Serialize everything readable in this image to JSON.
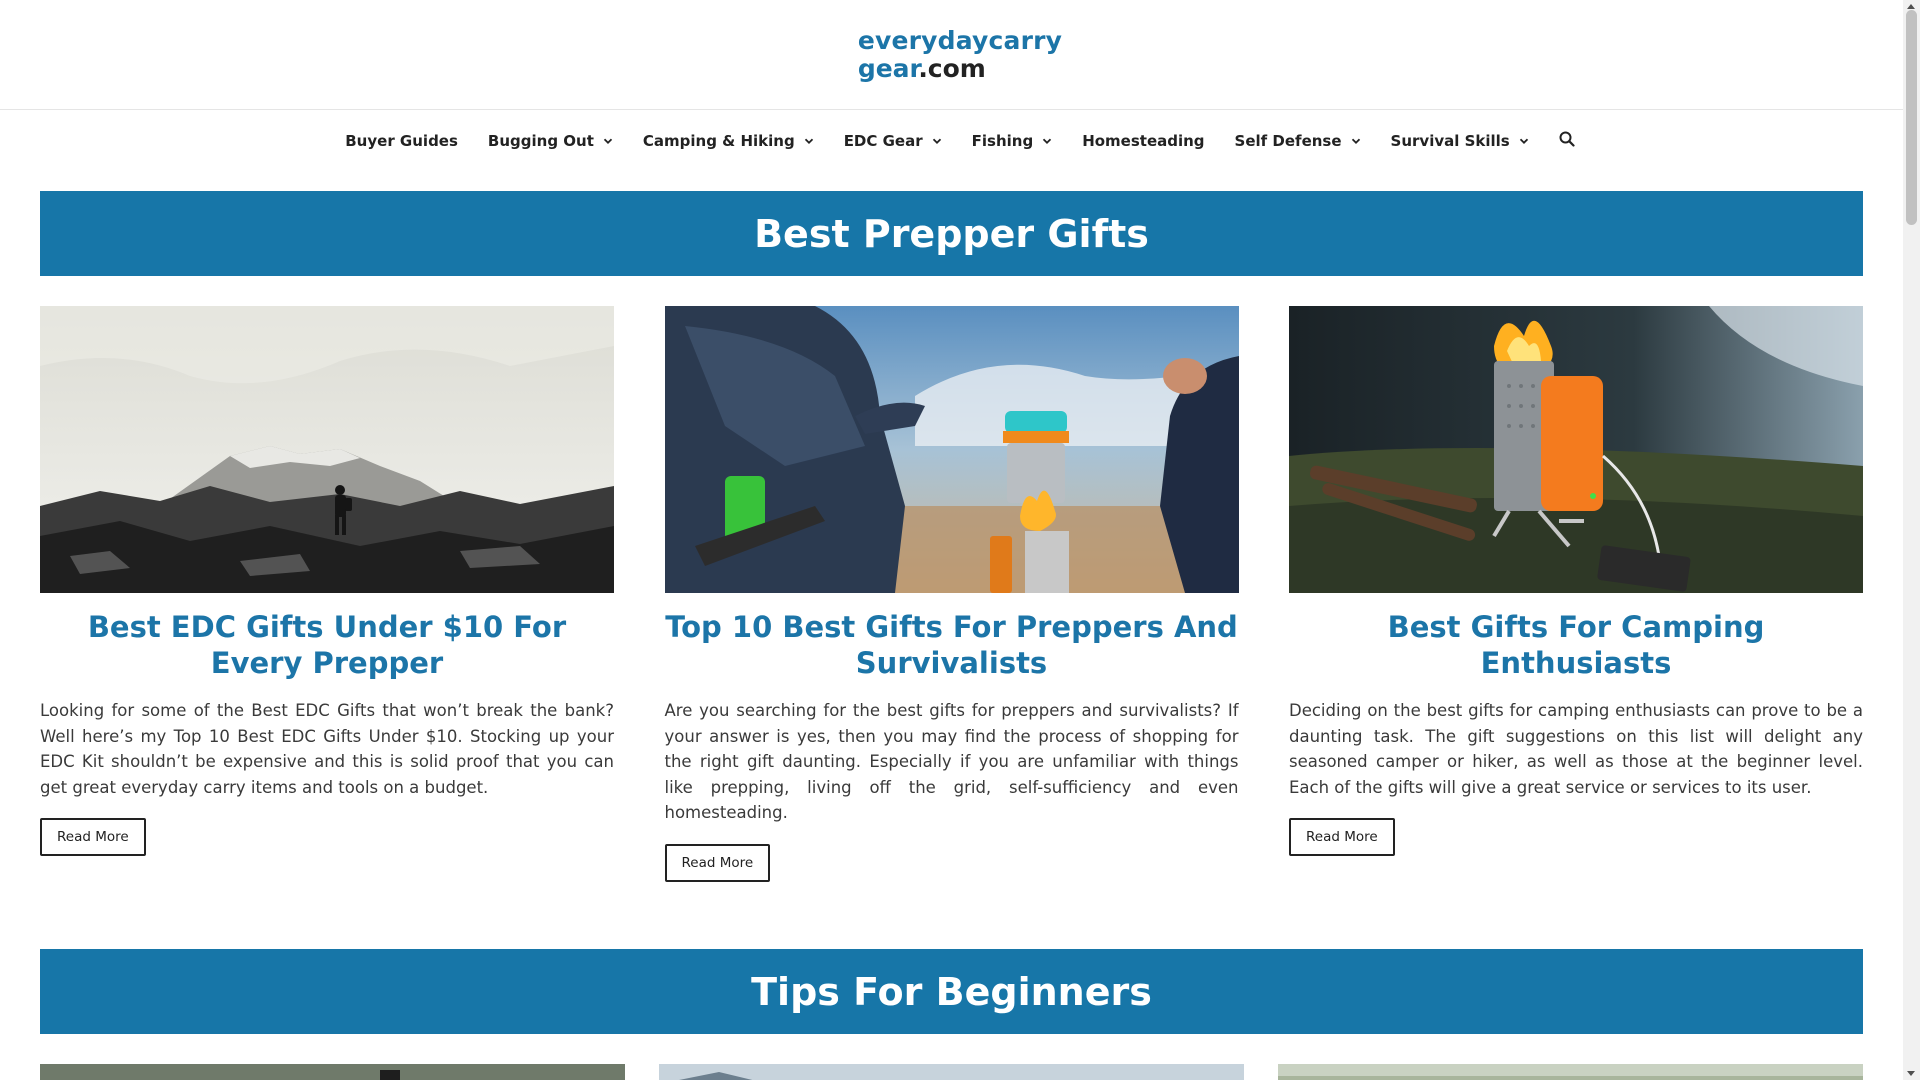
{
  "logo": {
    "line1": "everydaycarry",
    "line2_a": "gear",
    "line2_b": ".com"
  },
  "nav": {
    "items": [
      {
        "label": "Buyer Guides",
        "has_dropdown": false
      },
      {
        "label": "Bugging Out",
        "has_dropdown": true
      },
      {
        "label": "Camping & Hiking",
        "has_dropdown": true
      },
      {
        "label": "EDC Gear",
        "has_dropdown": true
      },
      {
        "label": "Fishing",
        "has_dropdown": true
      },
      {
        "label": "Homesteading",
        "has_dropdown": false
      },
      {
        "label": "Self Defense",
        "has_dropdown": true
      },
      {
        "label": "Survival Skills",
        "has_dropdown": true
      }
    ],
    "search_icon": "search-icon"
  },
  "sections": [
    {
      "heading": "Best Prepper Gifts",
      "cards": [
        {
          "title": "Best EDC Gifts Under $10 For Every Prepper",
          "excerpt": "Looking for some of the Best EDC Gifts that won’t break the bank? Well here’s my Top 10 Best EDC Gifts Under $10. Stocking up your EDC Kit shouldn’t be expensive and this is solid proof that you can get great everyday carry items and tools on a budget.",
          "button": "Read More"
        },
        {
          "title": "Top 10 Best Gifts For Preppers And Survivalists",
          "excerpt": "Are you searching for the best gifts for preppers and survivalists? If your answer is yes, then you may find the process of shopping for the right gift daunting. Especially if you are unfamiliar with things like prepping, living off the grid, self-sufficiency and even homesteading.",
          "button": "Read More"
        },
        {
          "title": "Best Gifts For Camping Enthusiasts",
          "excerpt": "Deciding on the best gifts for camping enthusiasts can prove to be a daunting task. The gift suggestions on this list will delight any seasoned camper or hiker, as well as those at the beginner level. Each of the gifts will give a great service or services to its user.",
          "button": "Read More"
        }
      ]
    },
    {
      "heading": "Tips For Beginners"
    }
  ],
  "colors": {
    "brand_blue": "#1776a8",
    "title_blue": "#1c75a8",
    "text": "#3a3a3a"
  }
}
